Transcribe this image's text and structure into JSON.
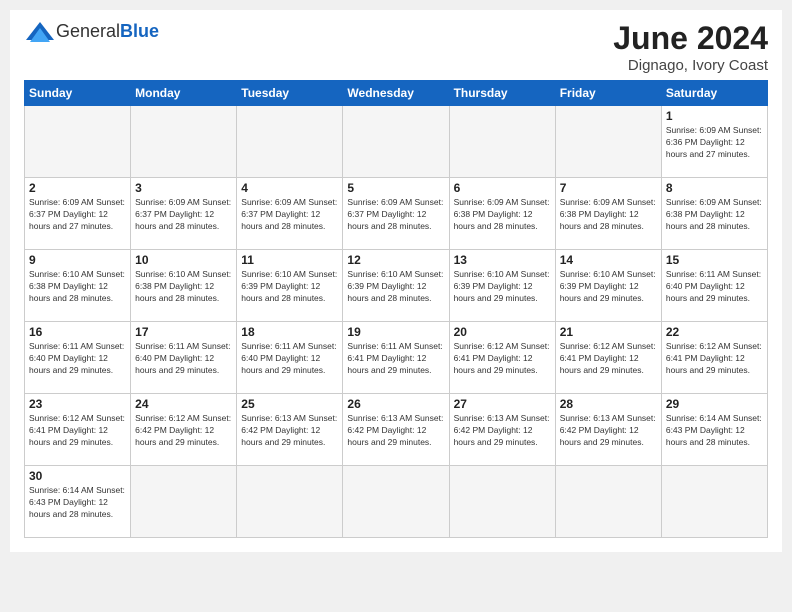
{
  "header": {
    "logo_general": "General",
    "logo_blue": "Blue",
    "title": "June 2024",
    "location": "Dignago, Ivory Coast"
  },
  "days_of_week": [
    "Sunday",
    "Monday",
    "Tuesday",
    "Wednesday",
    "Thursday",
    "Friday",
    "Saturday"
  ],
  "weeks": [
    [
      {
        "num": "",
        "info": ""
      },
      {
        "num": "",
        "info": ""
      },
      {
        "num": "",
        "info": ""
      },
      {
        "num": "",
        "info": ""
      },
      {
        "num": "",
        "info": ""
      },
      {
        "num": "",
        "info": ""
      },
      {
        "num": "1",
        "info": "Sunrise: 6:09 AM\nSunset: 6:36 PM\nDaylight: 12 hours and 27 minutes."
      }
    ],
    [
      {
        "num": "2",
        "info": "Sunrise: 6:09 AM\nSunset: 6:37 PM\nDaylight: 12 hours and 27 minutes."
      },
      {
        "num": "3",
        "info": "Sunrise: 6:09 AM\nSunset: 6:37 PM\nDaylight: 12 hours and 28 minutes."
      },
      {
        "num": "4",
        "info": "Sunrise: 6:09 AM\nSunset: 6:37 PM\nDaylight: 12 hours and 28 minutes."
      },
      {
        "num": "5",
        "info": "Sunrise: 6:09 AM\nSunset: 6:37 PM\nDaylight: 12 hours and 28 minutes."
      },
      {
        "num": "6",
        "info": "Sunrise: 6:09 AM\nSunset: 6:38 PM\nDaylight: 12 hours and 28 minutes."
      },
      {
        "num": "7",
        "info": "Sunrise: 6:09 AM\nSunset: 6:38 PM\nDaylight: 12 hours and 28 minutes."
      },
      {
        "num": "8",
        "info": "Sunrise: 6:09 AM\nSunset: 6:38 PM\nDaylight: 12 hours and 28 minutes."
      }
    ],
    [
      {
        "num": "9",
        "info": "Sunrise: 6:10 AM\nSunset: 6:38 PM\nDaylight: 12 hours and 28 minutes."
      },
      {
        "num": "10",
        "info": "Sunrise: 6:10 AM\nSunset: 6:38 PM\nDaylight: 12 hours and 28 minutes."
      },
      {
        "num": "11",
        "info": "Sunrise: 6:10 AM\nSunset: 6:39 PM\nDaylight: 12 hours and 28 minutes."
      },
      {
        "num": "12",
        "info": "Sunrise: 6:10 AM\nSunset: 6:39 PM\nDaylight: 12 hours and 28 minutes."
      },
      {
        "num": "13",
        "info": "Sunrise: 6:10 AM\nSunset: 6:39 PM\nDaylight: 12 hours and 29 minutes."
      },
      {
        "num": "14",
        "info": "Sunrise: 6:10 AM\nSunset: 6:39 PM\nDaylight: 12 hours and 29 minutes."
      },
      {
        "num": "15",
        "info": "Sunrise: 6:11 AM\nSunset: 6:40 PM\nDaylight: 12 hours and 29 minutes."
      }
    ],
    [
      {
        "num": "16",
        "info": "Sunrise: 6:11 AM\nSunset: 6:40 PM\nDaylight: 12 hours and 29 minutes."
      },
      {
        "num": "17",
        "info": "Sunrise: 6:11 AM\nSunset: 6:40 PM\nDaylight: 12 hours and 29 minutes."
      },
      {
        "num": "18",
        "info": "Sunrise: 6:11 AM\nSunset: 6:40 PM\nDaylight: 12 hours and 29 minutes."
      },
      {
        "num": "19",
        "info": "Sunrise: 6:11 AM\nSunset: 6:41 PM\nDaylight: 12 hours and 29 minutes."
      },
      {
        "num": "20",
        "info": "Sunrise: 6:12 AM\nSunset: 6:41 PM\nDaylight: 12 hours and 29 minutes."
      },
      {
        "num": "21",
        "info": "Sunrise: 6:12 AM\nSunset: 6:41 PM\nDaylight: 12 hours and 29 minutes."
      },
      {
        "num": "22",
        "info": "Sunrise: 6:12 AM\nSunset: 6:41 PM\nDaylight: 12 hours and 29 minutes."
      }
    ],
    [
      {
        "num": "23",
        "info": "Sunrise: 6:12 AM\nSunset: 6:41 PM\nDaylight: 12 hours and 29 minutes."
      },
      {
        "num": "24",
        "info": "Sunrise: 6:12 AM\nSunset: 6:42 PM\nDaylight: 12 hours and 29 minutes."
      },
      {
        "num": "25",
        "info": "Sunrise: 6:13 AM\nSunset: 6:42 PM\nDaylight: 12 hours and 29 minutes."
      },
      {
        "num": "26",
        "info": "Sunrise: 6:13 AM\nSunset: 6:42 PM\nDaylight: 12 hours and 29 minutes."
      },
      {
        "num": "27",
        "info": "Sunrise: 6:13 AM\nSunset: 6:42 PM\nDaylight: 12 hours and 29 minutes."
      },
      {
        "num": "28",
        "info": "Sunrise: 6:13 AM\nSunset: 6:42 PM\nDaylight: 12 hours and 29 minutes."
      },
      {
        "num": "29",
        "info": "Sunrise: 6:14 AM\nSunset: 6:43 PM\nDaylight: 12 hours and 28 minutes."
      }
    ],
    [
      {
        "num": "30",
        "info": "Sunrise: 6:14 AM\nSunset: 6:43 PM\nDaylight: 12 hours and 28 minutes."
      },
      {
        "num": "",
        "info": ""
      },
      {
        "num": "",
        "info": ""
      },
      {
        "num": "",
        "info": ""
      },
      {
        "num": "",
        "info": ""
      },
      {
        "num": "",
        "info": ""
      },
      {
        "num": "",
        "info": ""
      }
    ]
  ]
}
